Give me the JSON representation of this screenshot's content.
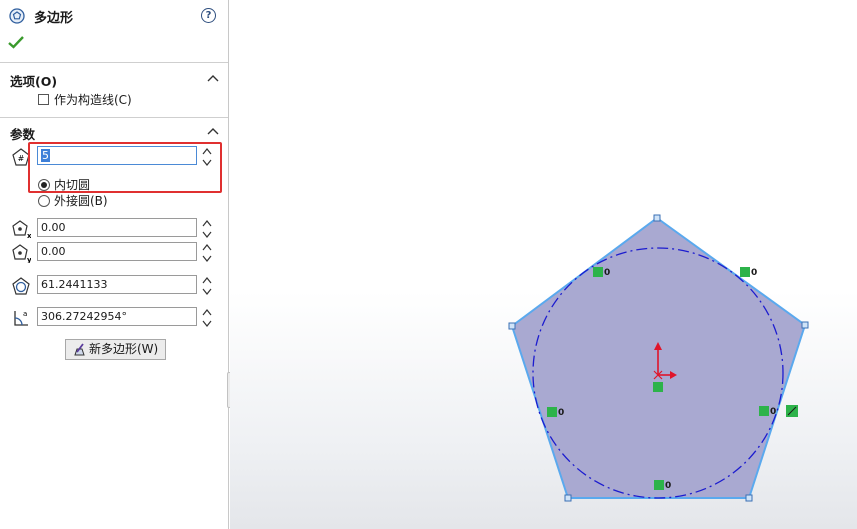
{
  "panel": {
    "title": "多边形",
    "help_icon": "question-circle-icon",
    "confirm_icon": "checkmark-icon",
    "options": {
      "header": "选项(O)",
      "construction_checkbox_label": "作为构造线(C)",
      "construction_checked": false
    },
    "params": {
      "header": "参数",
      "sides_value": "5",
      "inscribed_label": "内切圆",
      "circumscribed_label": "外接圆(B)",
      "selected_option": "内切圆",
      "center_x": "0.00",
      "center_y": "0.00",
      "diameter": "61.2441133",
      "angle": "306.27242954°"
    },
    "new_polygon_button": "新多边形(W)"
  },
  "canvas": {
    "relation_label": "0",
    "polygon_fill": "#a9a9d1",
    "polygon_stroke": "#5aa9ee",
    "circle_stroke": "#1c1ccf",
    "origin_color": "#e0152b"
  }
}
